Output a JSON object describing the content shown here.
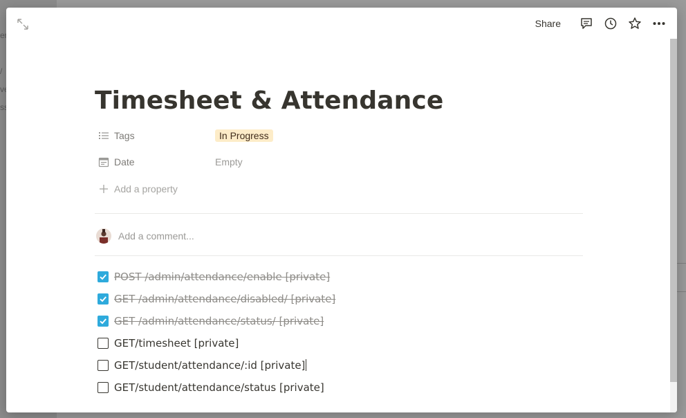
{
  "background": {
    "fragments": [
      "er",
      "/",
      "ve",
      "ss"
    ]
  },
  "topbar": {
    "share_label": "Share",
    "icons": [
      "comment-icon",
      "clock-icon",
      "star-icon",
      "more-icon"
    ]
  },
  "page": {
    "title": "Timesheet & Attendance",
    "properties": [
      {
        "name": "Tags",
        "icon": "list-icon",
        "value": "In Progress",
        "kind": "tag"
      },
      {
        "name": "Date",
        "icon": "calendar-icon",
        "value": "Empty",
        "kind": "empty"
      }
    ],
    "add_property_label": "Add a property",
    "comment_placeholder": "Add a comment...",
    "todos": [
      {
        "text": "POST /admin/attendance/enable [private]",
        "checked": true
      },
      {
        "text": "GET /admin/attendance/disabled/ [private]",
        "checked": true
      },
      {
        "text": "GET /admin/attendance/status/ [private]",
        "checked": true
      },
      {
        "text": "GET/timesheet [private]",
        "checked": false
      },
      {
        "text": "GET/student/attendance/:id [private]",
        "checked": false
      },
      {
        "text": "GET/student/attendance/status [private]",
        "checked": false
      }
    ]
  },
  "colors": {
    "tag_bg": "#fdecc8",
    "checkbox_checked": "#2eaadc",
    "text_primary": "#37352f",
    "text_muted": "#9b9a97"
  }
}
